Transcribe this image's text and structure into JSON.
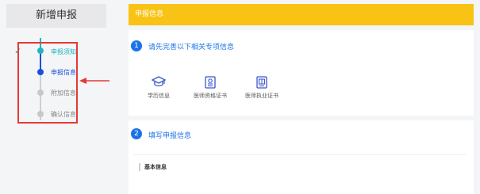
{
  "sidebar": {
    "title": "新增申报",
    "steps": [
      {
        "label": "申报须知",
        "state": "done"
      },
      {
        "label": "申报信息",
        "state": "current"
      },
      {
        "label": "附加信息",
        "state": "pending"
      },
      {
        "label": "确认信息",
        "state": "pending"
      }
    ],
    "check_icon": "✓"
  },
  "header": {
    "title": "申报信息"
  },
  "section1": {
    "number": "1",
    "title": "请先完善以下相关专项信息",
    "cards": [
      {
        "label": "学历信息",
        "icon": "graduation-cap-icon"
      },
      {
        "label": "医师资格证书",
        "icon": "certificate-icon"
      },
      {
        "label": "医师执业证书",
        "icon": "license-icon"
      }
    ]
  },
  "section2": {
    "number": "2",
    "title": "填写申报信息",
    "subsection": "基本信息"
  },
  "colors": {
    "accent_yellow": "#f8c314",
    "step_done": "#1fb6c1",
    "step_current": "#1a4fd8",
    "step_pending": "#c8c8c8",
    "annotation_red": "#e53935",
    "link_blue": "#1a73e8"
  }
}
